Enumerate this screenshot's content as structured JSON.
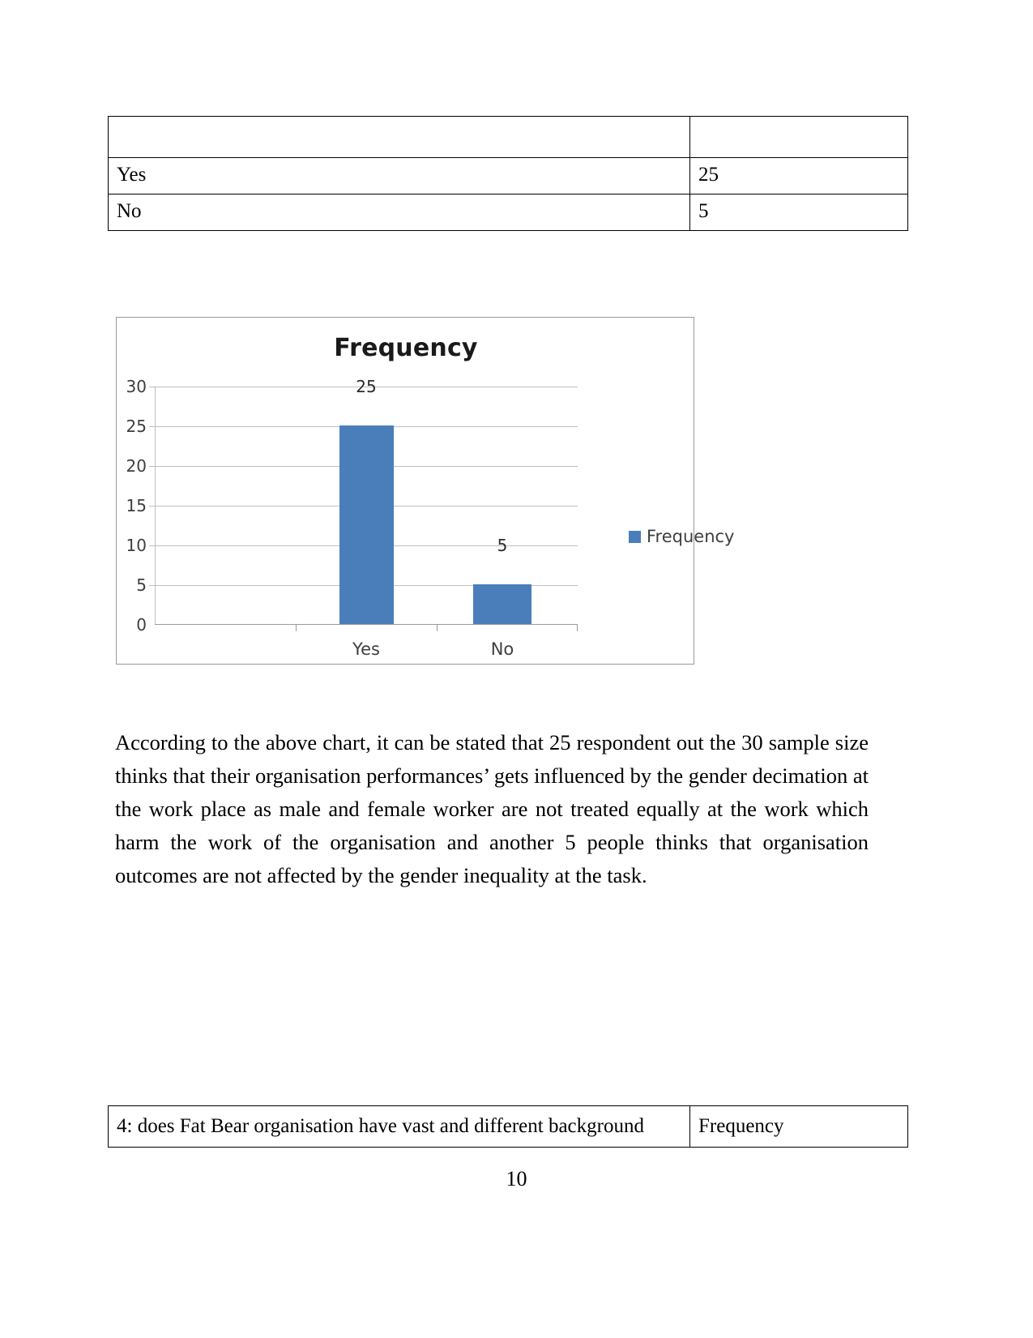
{
  "document": {
    "page_number": "10"
  },
  "top_table": {
    "header": {
      "label": "",
      "value": ""
    },
    "rows": [
      {
        "label": "Yes",
        "value": "25"
      },
      {
        "label": "No",
        "value": "5"
      }
    ]
  },
  "chart_data": {
    "type": "bar",
    "title": "Frequency",
    "categories": [
      "Yes",
      "No"
    ],
    "values": [
      25,
      5
    ],
    "series": [
      {
        "name": "Frequency",
        "values": [
          25,
          5
        ]
      }
    ],
    "data_labels": [
      "25",
      "5"
    ],
    "xlabel": "",
    "ylabel": "",
    "ylim": [
      0,
      30
    ],
    "ytick_labels": [
      "30",
      "25",
      "20",
      "15",
      "10",
      "5",
      "0"
    ],
    "ytick_values": [
      30,
      25,
      20,
      15,
      10,
      5,
      0
    ],
    "grid": true,
    "legend_position": "right",
    "legend": [
      "Frequency"
    ],
    "bar_color": "#4a7ebb",
    "gridline_color": "#bfbfbf",
    "plot_background": "#ffffff"
  },
  "paragraph": {
    "text": "According to the above chart, it can be stated that 25 respondent out the 30 sample  size thinks that their organisation performances’ gets influenced by  the gender decimation at the work place as male  and female worker are not treated equally at the work which harm  the work of the organisation and  another 5 people thinks that organisation outcomes are not affected by the gender inequality at the task."
  },
  "bottom_table": {
    "question": "4:  does Fat Bear organisation have vast and different background",
    "frequency_header": "Frequency"
  }
}
